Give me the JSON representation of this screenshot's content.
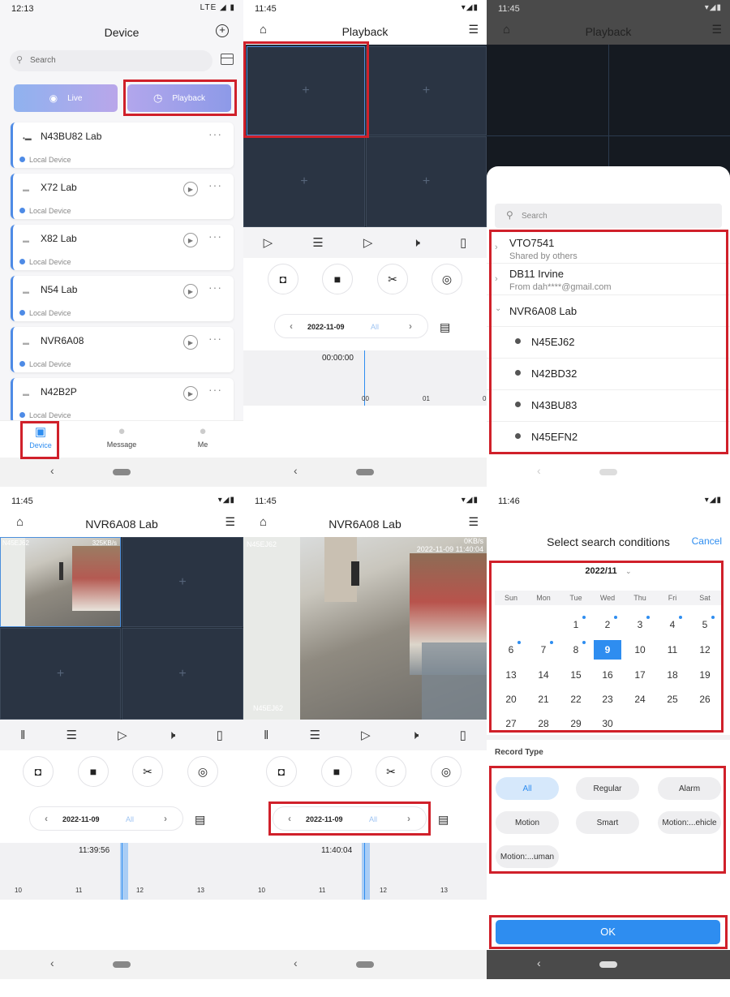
{
  "p1": {
    "time": "12:13",
    "status": "LTE",
    "title": "Device",
    "search_placeholder": "Search",
    "live_label": "Live",
    "playback_label": "Playback",
    "devices": [
      {
        "name": "N43BU82 Lab",
        "sub": "Local Device"
      },
      {
        "name": "X72 Lab",
        "sub": "Local Device"
      },
      {
        "name": "X82 Lab",
        "sub": "Local Device"
      },
      {
        "name": "N54 Lab",
        "sub": "Local Device"
      },
      {
        "name": "NVR6A08",
        "sub": "Local Device"
      },
      {
        "name": "N42B2P",
        "sub": "Local Device"
      }
    ],
    "tabs": {
      "device": "Device",
      "message": "Message",
      "me": "Me"
    }
  },
  "p2": {
    "time": "11:45",
    "title": "Playback",
    "date": "2022-11-09",
    "filter": "All",
    "time_readout": "00:00:00",
    "ticks": [
      "00",
      "01",
      "0"
    ]
  },
  "p3": {
    "time": "11:45",
    "title": "Playback",
    "search_placeholder": "Search",
    "tree": [
      {
        "name": "VTO7541",
        "sub": "Shared by others"
      },
      {
        "name": "DB11 Irvine",
        "sub": "From dah****@gmail.com"
      },
      {
        "name": "NVR6A08 Lab",
        "sub": ""
      }
    ],
    "channels": [
      "N45EJ62",
      "N42BD32",
      "N43BU83",
      "N45EFN2"
    ]
  },
  "p4": {
    "time": "11:45",
    "title": "NVR6A08 Lab",
    "cam_label": "N45EJ62",
    "cam_rate": "325KB/s",
    "date": "2022-11-09",
    "filter": "All",
    "time_readout": "11:39:56",
    "ticks": [
      "10",
      "11",
      "12",
      "13"
    ]
  },
  "p5": {
    "time": "11:45",
    "title": "NVR6A08 Lab",
    "cam_label_top": "N45EJ62",
    "cam_ts": "2022-11-09 11:40:04",
    "cam_rate": "0KB/s",
    "cam_label_bottom": "N45EJ62",
    "date": "2022-11-09",
    "filter": "All",
    "time_readout": "11:40:04",
    "ticks": [
      "10",
      "11",
      "12",
      "13"
    ]
  },
  "p6": {
    "time": "11:46",
    "title": "Select search conditions",
    "cancel": "Cancel",
    "month": "2022/11",
    "weekdays": [
      "Sun",
      "Mon",
      "Tue",
      "Wed",
      "Thu",
      "Fri",
      "Sat"
    ],
    "days": [
      "1",
      "2",
      "3",
      "4",
      "5",
      "6",
      "7",
      "8",
      "9",
      "10",
      "11",
      "12",
      "13",
      "14",
      "15",
      "16",
      "17",
      "18",
      "19",
      "20",
      "21",
      "22",
      "23",
      "24",
      "25",
      "26",
      "27",
      "28",
      "29",
      "30"
    ],
    "record_type_label": "Record Type",
    "record_types": [
      "All",
      "Regular",
      "Alarm",
      "Motion",
      "Smart",
      "Motion:...ehicle",
      "Motion:...uman"
    ],
    "ok": "OK"
  },
  "colors": {
    "accent": "#2e8df0",
    "highlight": "#d0202a",
    "grid": "#2a3443"
  }
}
